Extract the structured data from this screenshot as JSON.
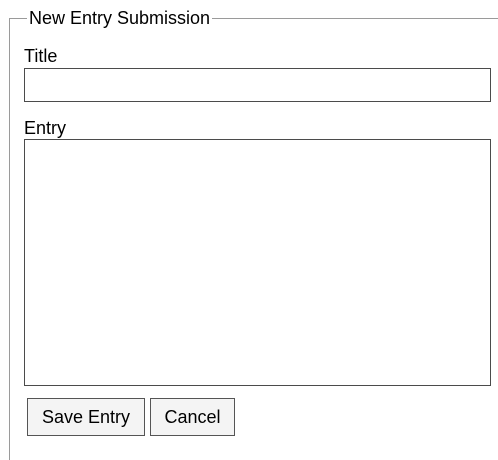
{
  "form": {
    "legend": "New Entry Submission",
    "title_label": "Title",
    "title_value": "",
    "entry_label": "Entry",
    "entry_value": "",
    "save_label": "Save Entry",
    "cancel_label": "Cancel"
  },
  "colors": {
    "fieldset_border": "#9a9a9a",
    "input_border": "#4b4b4b",
    "button_background": "#f4f4f4",
    "button_border": "#555555"
  }
}
